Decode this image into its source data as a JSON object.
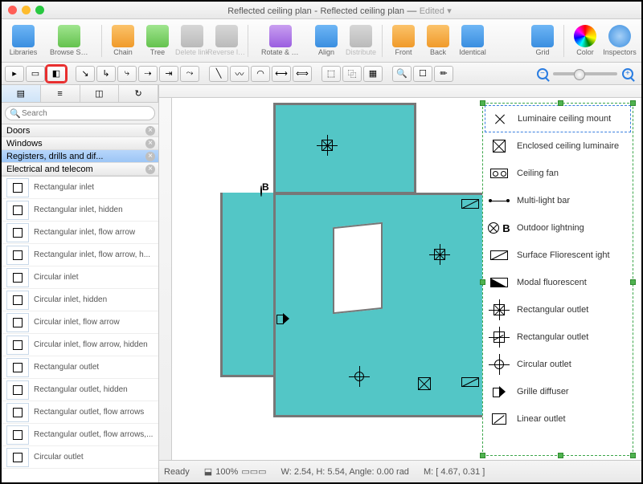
{
  "title": {
    "doc": "Reflected ceiling plan",
    "sheet": "Reflected ceiling plan",
    "state": "Edited"
  },
  "ribbon": {
    "libraries": "Libraries",
    "browse": "Browse Solutions",
    "chain": "Chain",
    "tree": "Tree",
    "deletelink": "Delete link",
    "reverselink": "Reverse link",
    "rotate": "Rotate & Flip",
    "align": "Align",
    "distribute": "Distribute",
    "front": "Front",
    "back": "Back",
    "identical": "Identical",
    "grid": "Grid",
    "color": "Color",
    "inspectors": "Inspectors"
  },
  "search": {
    "placeholder": "Search"
  },
  "categories": [
    {
      "label": "Doors",
      "selected": false
    },
    {
      "label": "Windows",
      "selected": false
    },
    {
      "label": "Registers, drills and dif...",
      "selected": true
    },
    {
      "label": "Electrical and telecom",
      "selected": false
    }
  ],
  "shapes": [
    "Rectangular inlet",
    "Rectangular inlet, hidden",
    "Rectangular inlet, flow arrow",
    "Rectangular inlet, flow arrow, h...",
    "Circular inlet",
    "Circular inlet, hidden",
    "Circular inlet, flow arrow",
    "Circular inlet, flow arrow, hidden",
    "Rectangular outlet",
    "Rectangular outlet, hidden",
    "Rectangular outlet, flow arrows",
    "Rectangular outlet, flow arrows,...",
    "Circular outlet"
  ],
  "legend": [
    {
      "label": "Luminaire ceiling mount",
      "sym": "x",
      "selected": true
    },
    {
      "label": "Enclosed ceiling luminaire",
      "sym": "sq-x"
    },
    {
      "label": "Ceiling fan",
      "sym": "oo"
    },
    {
      "label": "Multi-light bar",
      "sym": "bar"
    },
    {
      "label": "Outdoor lightning",
      "sym": "circlex",
      "extra": "B"
    },
    {
      "label": "Surface Fliorescent ight",
      "sym": "diag"
    },
    {
      "label": "Modal fluorescent",
      "sym": "half"
    },
    {
      "label": "Rectangular outlet",
      "sym": "arr-sq-x"
    },
    {
      "label": "Rectangular outlet",
      "sym": "arr-sq-d"
    },
    {
      "label": "Circular outlet",
      "sym": "arr-circ"
    },
    {
      "label": "Grille diffuser",
      "sym": "spk"
    },
    {
      "label": "Linear outlet",
      "sym": "lin"
    }
  ],
  "status": {
    "ready": "Ready",
    "zoom": "100%",
    "wh": "W: 2.54,  H: 5.54,  Angle: 0.00 rad",
    "mouse": "M: [ 4.67, 0.31 ]"
  },
  "colors": {
    "accent": "#53c6c6",
    "select_red": "#e82e2e",
    "legend_border": "#3ca64a"
  }
}
